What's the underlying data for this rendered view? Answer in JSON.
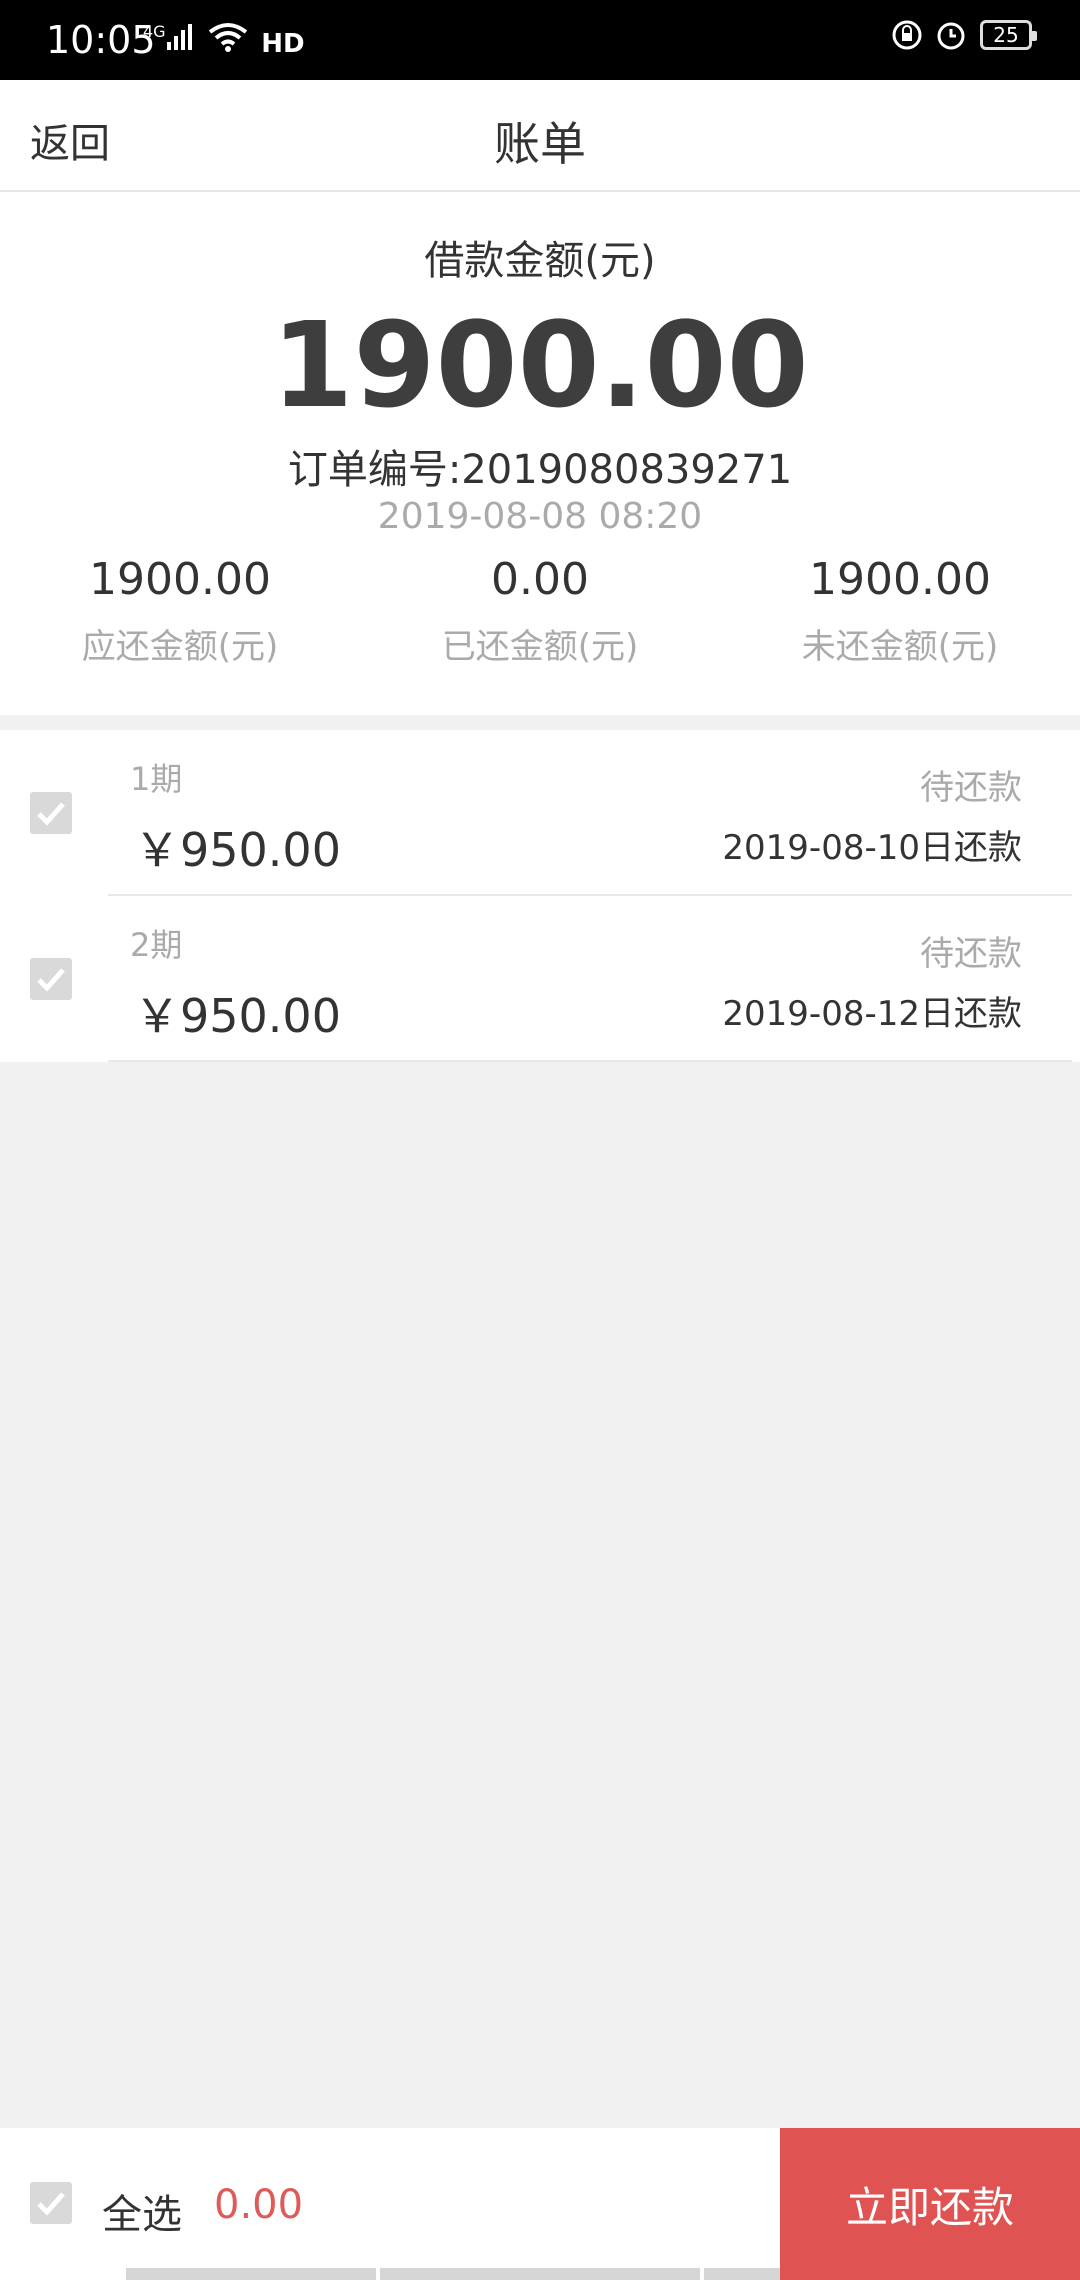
{
  "status_bar": {
    "time": "10:05",
    "network": "4G",
    "hd": "HD",
    "battery": "25"
  },
  "nav": {
    "back_label": "返回",
    "title": "账单"
  },
  "summary": {
    "loan_label": "借款金额(元)",
    "loan_amount": "1900.00",
    "order_no": "订单编号:2019080839271",
    "order_time": "2019-08-08 08:20",
    "stats": [
      {
        "value": "1900.00",
        "label": "应还金额(元)"
      },
      {
        "value": "0.00",
        "label": "已还金额(元)"
      },
      {
        "value": "1900.00",
        "label": "未还金额(元)"
      }
    ]
  },
  "installments": [
    {
      "period": "1期",
      "amount": "￥950.00",
      "status": "待还款",
      "due": "2019-08-10日还款"
    },
    {
      "period": "2期",
      "amount": "￥950.00",
      "status": "待还款",
      "due": "2019-08-12日还款"
    }
  ],
  "bottom": {
    "select_all_label": "全选",
    "total": "0.00",
    "pay_button": "立即还款"
  },
  "colors": {
    "accent": "#e05353",
    "muted": "#aaaaaa",
    "checkbox": "#d9d9d9"
  }
}
